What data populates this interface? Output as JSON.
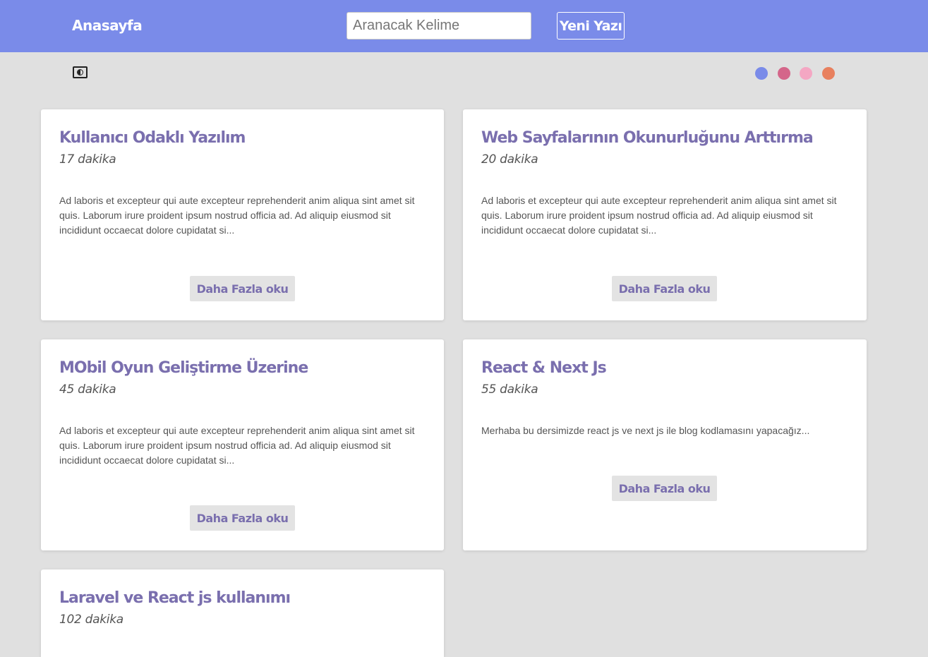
{
  "navbar": {
    "home_label": "Anasayfa",
    "search_placeholder": "Aranacak Kelime",
    "search_value": "",
    "new_post_label": "Yeni Yazı"
  },
  "theme_toggle": {
    "icon": "contrast-icon"
  },
  "color_swatches": [
    "#7a8be9",
    "#d4668a",
    "#f4a7c3",
    "#e8805e"
  ],
  "read_more_label": "Daha Fazla oku",
  "posts": [
    {
      "title": "Kullanıcı Odaklı Yazılım",
      "duration": "17 dakika",
      "excerpt": "Ad laboris et excepteur qui aute excepteur reprehenderit anim aliqua sint amet sit quis. Laborum irure proident ipsum nostrud officia ad. Ad aliquip eiusmod sit incididunt occaecat dolore cupidatat si..."
    },
    {
      "title": "Web Sayfalarının Okunurluğunu Arttırma",
      "duration": "20 dakika",
      "excerpt": "Ad laboris et excepteur qui aute excepteur reprehenderit anim aliqua sint amet sit quis. Laborum irure proident ipsum nostrud officia ad. Ad aliquip eiusmod sit incididunt occaecat dolore cupidatat si..."
    },
    {
      "title": "MObil Oyun Geliştirme Üzerine",
      "duration": "45 dakika",
      "excerpt": "Ad laboris et excepteur qui aute excepteur reprehenderit anim aliqua sint amet sit quis. Laborum irure proident ipsum nostrud officia ad. Ad aliquip eiusmod sit incididunt occaecat dolore cupidatat si..."
    },
    {
      "title": "React & Next Js",
      "duration": "55 dakika",
      "excerpt": "Merhaba bu dersimizde react js ve next js ile blog kodlamasını yapacağız..."
    },
    {
      "title": "Laravel ve React js kullanımı",
      "duration": "102 dakika",
      "excerpt": ""
    }
  ]
}
